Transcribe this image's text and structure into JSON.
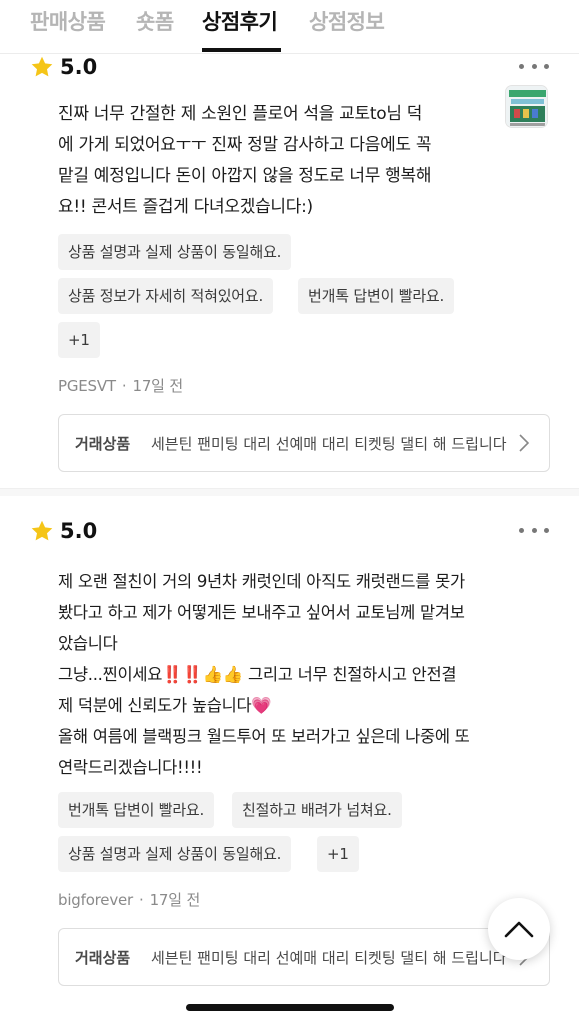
{
  "tabs": [
    {
      "label": "판매상품"
    },
    {
      "label": "숏폼"
    },
    {
      "label": "상점후기",
      "active": true
    },
    {
      "label": "상점정보"
    }
  ],
  "colors": {
    "star": "#f5c518",
    "text": "#1a1a1a",
    "muted": "#8a8a8a",
    "tag_bg": "#f2f2f2"
  },
  "reviews": [
    {
      "rating": "5.0",
      "text_lines": [
        "진짜 너무 간절한 제 소원인 플로어 석을 교토to님 덕",
        "에 가게 되었어요ㅜㅜ 진짜 정말 감사하고 다음에도 꼭",
        "맡길 예정입니다 돈이 아깝지 않을 정도로 너무 행복해",
        "요!! 콘서트 즐겁게 다녀오겠습니다:)"
      ],
      "tags": [
        "상품 설명과 실제 상품이 동일해요.",
        "상품 정보가 자세히 적혀있어요.",
        "번개톡 답변이 빨라요.",
        "+1"
      ],
      "author": "PGESVT",
      "time": "17일 전",
      "trade_label": "거래상품",
      "trade_title": "세븐틴 팬미팅 대리 선예매 대리 티켓팅 댈티 해 드립니다"
    },
    {
      "rating": "5.0",
      "text_lines": [
        "제 오랜 절친이 거의 9년차 캐럿인데 아직도 캐럿랜드를 못가",
        "봤다고 하고 제가 어떻게든 보내주고 싶어서 교토님께 맡겨보",
        "았습니다",
        "그냥...찐이세요‼️‼️👍👍 그리고 너무 친절하시고 안전결",
        "제 덕분에 신뢰도가 높습니다💗",
        "올해 여름에 블랙핑크 월드투어 또 보러가고 싶은데 나중에 또",
        "연락드리겠습니다!!!!"
      ],
      "tags": [
        "번개톡 답변이 빨라요.",
        "친절하고 배려가 넘쳐요.",
        "상품 설명과 실제 상품이 동일해요.",
        "+1"
      ],
      "author": "bigforever",
      "time": "17일 전",
      "trade_label": "거래상품",
      "trade_title": "세븐틴 팬미팅 대리 선예매 대리 티켓팅 댈티 해 드립니다"
    }
  ]
}
